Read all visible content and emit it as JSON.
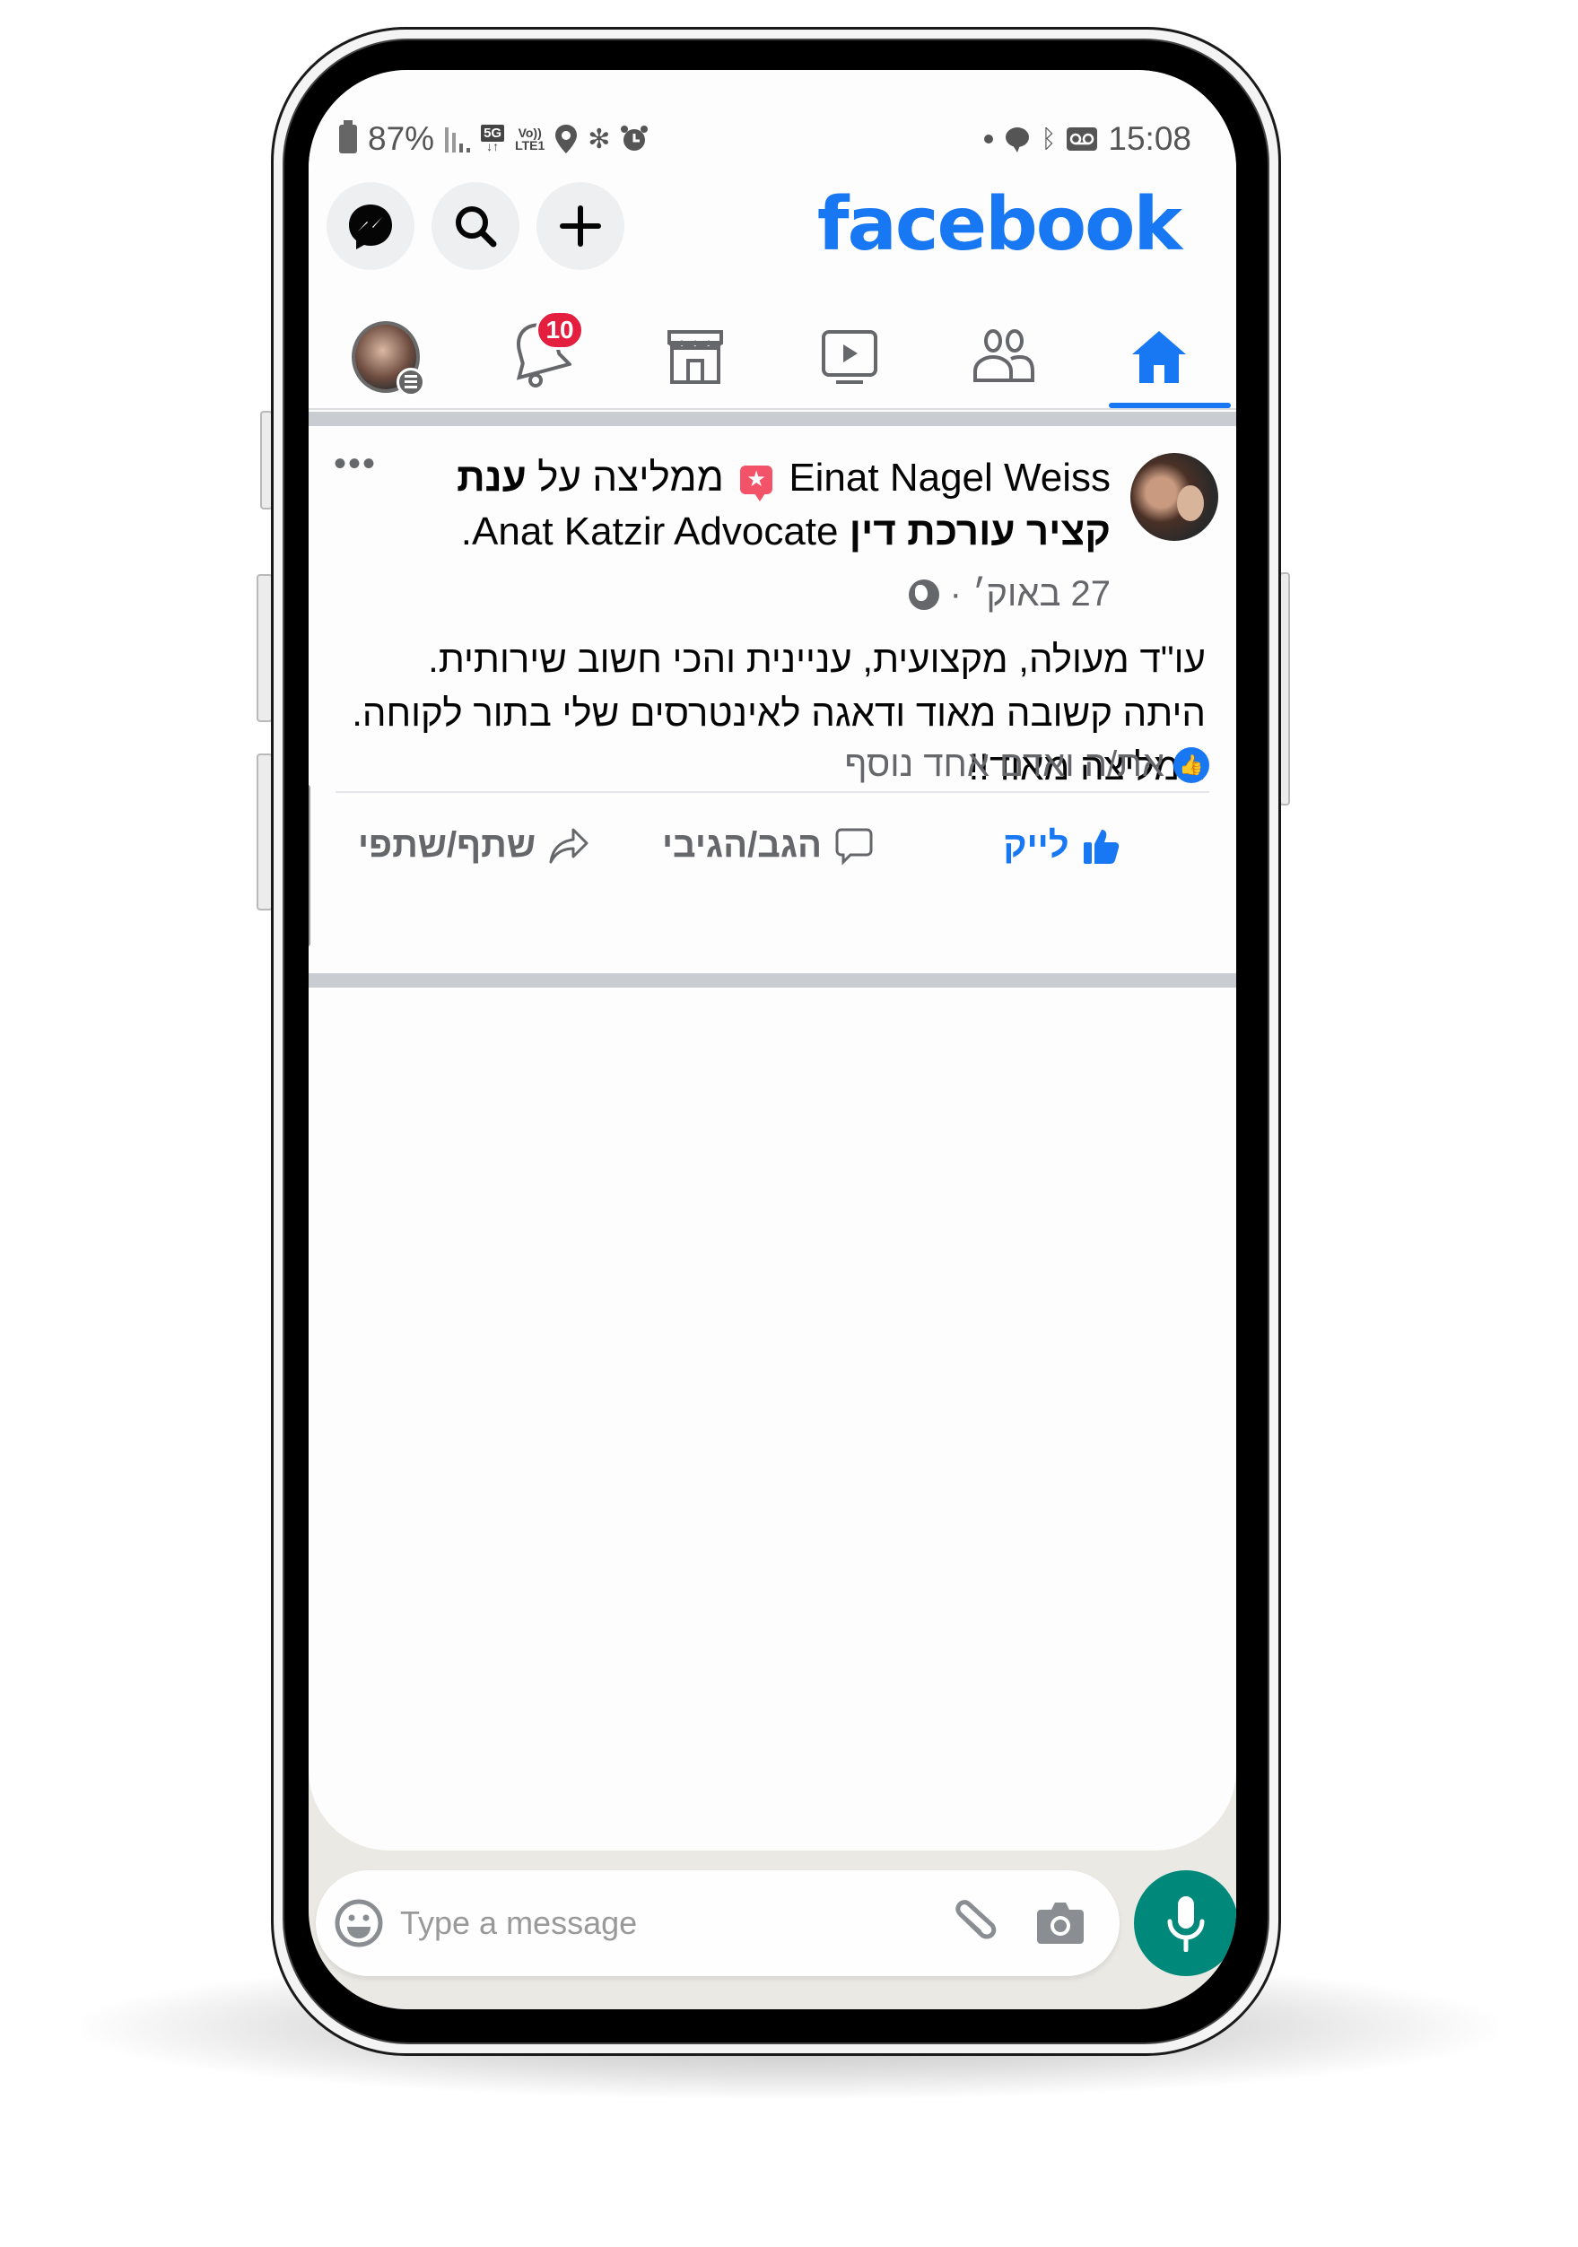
{
  "status_bar": {
    "battery": "87%",
    "network_5g": "5G",
    "volte": "Vo))",
    "lte": "LTE1",
    "time": "15:08"
  },
  "header": {
    "logo": "facebook",
    "buttons": [
      {
        "name": "messenger",
        "icon": "messenger-icon"
      },
      {
        "name": "search",
        "icon": "search-icon"
      },
      {
        "name": "create",
        "icon": "plus-icon"
      }
    ]
  },
  "tabs": [
    {
      "name": "menu",
      "icon": "profile-menu-icon",
      "active": false
    },
    {
      "name": "notifications",
      "icon": "bell-icon",
      "badge": "10",
      "active": false
    },
    {
      "name": "marketplace",
      "icon": "store-icon",
      "active": false
    },
    {
      "name": "watch",
      "icon": "video-icon",
      "active": false
    },
    {
      "name": "friends",
      "icon": "friends-icon",
      "active": false
    },
    {
      "name": "home",
      "icon": "home-icon",
      "active": true
    }
  ],
  "post": {
    "author": "Einat Nagel Weiss",
    "recommends_text": "ממליצה על",
    "page_name_hebrew": "ענת קציר",
    "page_name_line2_hebrew": "עורכת דין",
    "page_name_english": "Anat Katzir Advocate.",
    "date": "27 באוק׳",
    "dot_separator": "·",
    "more": "•••",
    "body": "עו\"ד מעולה, מקצועית, עניינית והכי חשוב שירותית. היתה קשובה מאוד ודאגה לאינטרסים שלי בתור לקוחה. ממליצה מאוד!!",
    "reactions_text": "את/ה ואדם אחד נוסף",
    "actions": {
      "like": "לייק",
      "comment": "הגב/הגיבי",
      "share": "שתף/שתפי"
    }
  },
  "message_bar": {
    "placeholder": "Type a message"
  },
  "colors": {
    "facebook_blue": "#1877f2",
    "badge_red": "#e41e3f",
    "whatsapp_green": "#00897b",
    "recommend_pink": "#f35369"
  }
}
